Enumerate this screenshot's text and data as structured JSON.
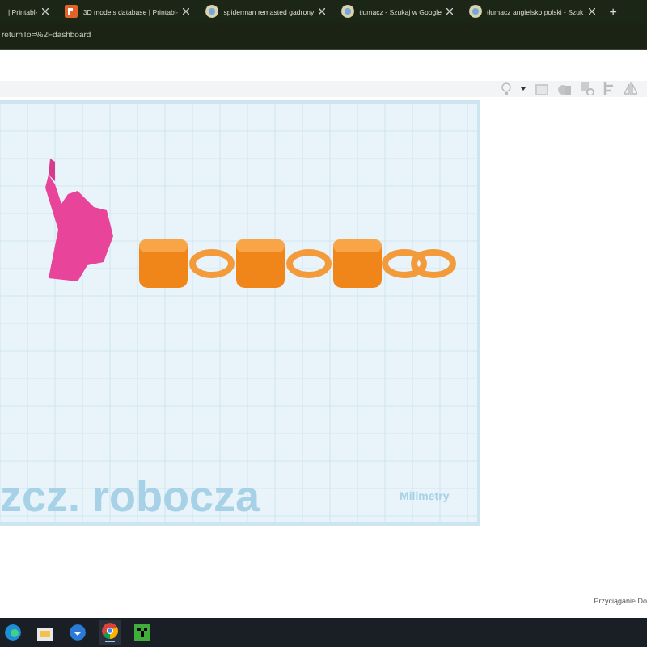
{
  "browser_tabs": [
    {
      "label": "| Printabl·",
      "selected": false
    },
    {
      "label": "3D models database | Printabl·",
      "selected": false
    },
    {
      "label": "spiderman remasted gadrony",
      "selected": false
    },
    {
      "label": "tłumacz - Szukaj w Google",
      "selected": false
    },
    {
      "label": "tłumacz angielsko polski - Szuk",
      "selected": false
    }
  ],
  "new_tab": "+",
  "address_bar": {
    "value": "returnTo=%2Fdashboard"
  },
  "workplane": {
    "label": "zcz. robocza",
    "units": "Milimetry"
  },
  "snap_label": "Przyciąganie Do",
  "taskbar": [
    {
      "kind": "edge",
      "selected": false
    },
    {
      "kind": "explorer",
      "selected": false
    },
    {
      "kind": "store",
      "selected": false
    },
    {
      "kind": "chrome",
      "selected": true
    },
    {
      "kind": "minecraft",
      "selected": false
    }
  ]
}
